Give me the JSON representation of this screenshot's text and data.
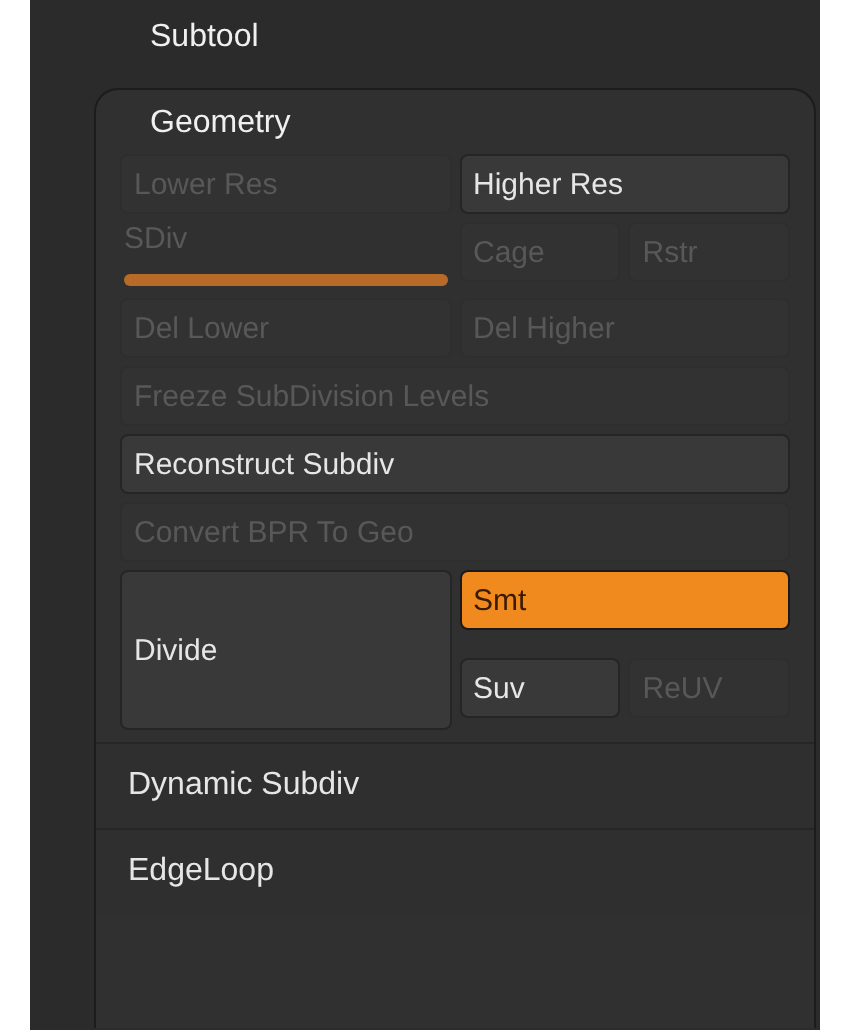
{
  "panel_title": "Subtool",
  "geometry": {
    "title": "Geometry",
    "rows": [
      {
        "items": [
          {
            "kind": "button",
            "label": "Lower Res",
            "disabled": true
          },
          {
            "kind": "button",
            "label": "Higher Res",
            "disabled": false
          }
        ]
      },
      {
        "items": [
          {
            "kind": "slider",
            "label": "SDiv",
            "disabled": true,
            "level": 1
          },
          {
            "kind": "pair",
            "buttons": [
              {
                "label": "Cage",
                "disabled": true
              },
              {
                "label": "Rstr",
                "disabled": true
              }
            ]
          }
        ]
      },
      {
        "items": [
          {
            "kind": "button",
            "label": "Del Lower",
            "disabled": true
          },
          {
            "kind": "button",
            "label": "Del Higher",
            "disabled": true
          }
        ]
      },
      {
        "items": [
          {
            "kind": "wide",
            "label": "Freeze SubDivision Levels",
            "disabled": true
          }
        ]
      },
      {
        "items": [
          {
            "kind": "wide",
            "label": "Reconstruct Subdiv",
            "disabled": false
          }
        ]
      },
      {
        "items": [
          {
            "kind": "wide",
            "label": "Convert BPR To Geo",
            "disabled": true
          }
        ]
      }
    ],
    "divide": {
      "label": "Divide",
      "disabled": false,
      "toggles": [
        {
          "label": "Smt",
          "selected": true,
          "disabled": false
        },
        {
          "label": "Suv",
          "selected": false,
          "disabled": false
        },
        {
          "label": "ReUV",
          "selected": false,
          "disabled": true
        }
      ]
    }
  },
  "subpanels": [
    {
      "label": "Dynamic Subdiv"
    },
    {
      "label": "EdgeLoop"
    }
  ]
}
